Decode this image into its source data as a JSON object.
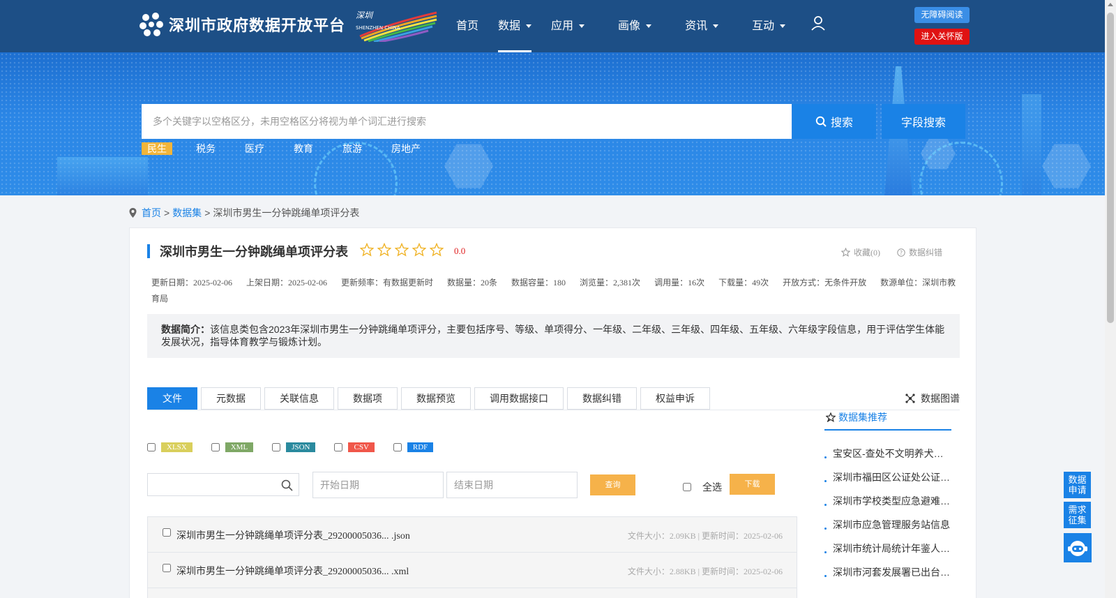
{
  "header": {
    "site_title": "深圳市政府数据开放平台",
    "nav": [
      {
        "label": "首页",
        "dropdown": false
      },
      {
        "label": "数据",
        "dropdown": true,
        "active": true
      },
      {
        "label": "应用",
        "dropdown": true
      },
      {
        "label": "画像",
        "dropdown": true
      },
      {
        "label": "资讯",
        "dropdown": true
      },
      {
        "label": "互动",
        "dropdown": true
      }
    ],
    "accessible_reading": "无障碍阅读",
    "elderly_mode": "进入关怀版"
  },
  "search": {
    "placeholder": "多个关键字以空格区分，未用空格区分将视为单个词汇进行搜索",
    "search_label": "搜索",
    "field_search_label": "字段搜索",
    "hot_tags": [
      "民生",
      "税务",
      "医疗",
      "教育",
      "旅游",
      "房地产"
    ]
  },
  "breadcrumb": {
    "home": "首页",
    "dataset": "数据集",
    "current": "深圳市男生一分钟跳绳单项评分表",
    "separator": ">"
  },
  "detail": {
    "title": "深圳市男生一分钟跳绳单项评分表",
    "rating": 0,
    "score": "0.0",
    "favorite": "收藏(0)",
    "correction": "数据纠错",
    "meta": [
      "更新日期：2025-02-06",
      "上架日期：2025-02-06",
      "更新频率：有数据更新时",
      "数据量：20条",
      "数据容量：180",
      "浏览量：2,381次",
      "调用量：16次",
      "下载量：49次",
      "开放方式：无条件开放",
      "数源单位：深圳市教育局"
    ],
    "desc_label": "数据简介：",
    "desc_text": "该信息类包含2023年深圳市男生一分钟跳绳单项评分，主要包括序号、等级、单项得分、一年级、二年级、三年级、四年级、五年级、六年级字段信息，用于评估学生体能发展状况，指导体育教学与锻炼计划。"
  },
  "tabs": [
    "文件",
    "元数据",
    "关联信息",
    "数据项",
    "数据预览",
    "调用数据接口",
    "数据纠错",
    "权益申诉"
  ],
  "graph_link": "数据图谱",
  "formats": [
    {
      "label": "XLSX",
      "color": "#d9cf5c"
    },
    {
      "label": "XML",
      "color": "#7fa866"
    },
    {
      "label": "JSON",
      "color": "#2a8a9e"
    },
    {
      "label": "CSV",
      "color": "#f0574a"
    },
    {
      "label": "RDF",
      "color": "#1a82e6"
    }
  ],
  "filters": {
    "start_date": "开始日期",
    "end_date": "结束日期",
    "query": "查询",
    "select_all": "全选",
    "download": "下载"
  },
  "files": [
    {
      "name": "深圳市男生一分钟跳绳单项评分表_29200005036... .json",
      "info": "文件大小：2.09KB | 更新时间：2025-02-06"
    },
    {
      "name": "深圳市男生一分钟跳绳单项评分表_29200005036... .xml",
      "info": "文件大小：2.88KB | 更新时间：2025-02-06"
    }
  ],
  "recommend": {
    "title": "数据集推荐",
    "items": [
      "宝安区-查处不文明养犬…",
      "深圳市福田区公证处公证…",
      "深圳市学校类型应急避难…",
      "深圳市应急管理服务站信息",
      "深圳市统计局统计年鉴人…",
      "深圳市河套发展署已出台…"
    ]
  },
  "float": {
    "apply": "数据申请",
    "demand": "需求征集"
  },
  "colors": {
    "header_bg": "#1d4f86",
    "accent": "#1a82e6",
    "tag_active": "#f2b53a",
    "action_orange": "#f6b24a",
    "score_red": "#e02020"
  }
}
